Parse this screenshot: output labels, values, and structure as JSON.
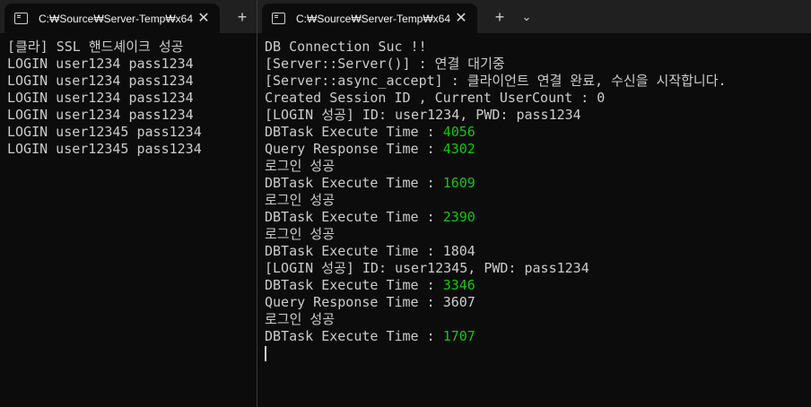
{
  "left_pane": {
    "tab_title": "C:₩Source₩Server-Temp₩x64",
    "lines": [
      "[클라] SSL 핸드셰이크 성공",
      "LOGIN user1234 pass1234",
      "LOGIN user1234 pass1234",
      "LOGIN user1234 pass1234",
      "LOGIN user1234 pass1234",
      "LOGIN user12345 pass1234",
      "LOGIN user12345 pass1234"
    ]
  },
  "right_pane": {
    "tab_title": "C:₩Source₩Server-Temp₩x64",
    "lines": [
      {
        "text": "DB Connection Suc !!"
      },
      {
        "text": "[Server::Server()] : 연결 대기중"
      },
      {
        "text": "[Server::async_accept] : 클라이언트 연결 완료, 수신을 시작합니다."
      },
      {
        "text": "Created Session ID , Current UserCount : 0"
      },
      {
        "text": "[LOGIN 성공] ID: user1234, PWD: pass1234"
      },
      {
        "text": "DBTask Execute Time : ",
        "value": "4056",
        "highlight": true
      },
      {
        "text": "Query Response Time : ",
        "value": "4302",
        "highlight": true
      },
      {
        "text": "로그인 성공"
      },
      {
        "text": "DBTask Execute Time : ",
        "value": "1609",
        "highlight": true
      },
      {
        "text": "로그인 성공"
      },
      {
        "text": "DBTask Execute Time : ",
        "value": "2390",
        "highlight": true
      },
      {
        "text": "로그인 성공"
      },
      {
        "text": "DBTask Execute Time : ",
        "value": "1804",
        "highlight": false
      },
      {
        "text": "[LOGIN 성공] ID: user12345, PWD: pass1234"
      },
      {
        "text": "DBTask Execute Time : ",
        "value": "3346",
        "highlight": true
      },
      {
        "text": "Query Response Time : ",
        "value": "3607",
        "highlight": false
      },
      {
        "text": "로그인 성공"
      },
      {
        "text": "DBTask Execute Time : ",
        "value": "1707",
        "highlight": true
      }
    ]
  },
  "tab_buttons": {
    "close": "✕",
    "new_tab": "+",
    "dropdown": "⌄"
  },
  "colors": {
    "background": "#0c0c0c",
    "tabbar": "#202020",
    "text": "#cccccc",
    "highlight": "#16c60c"
  }
}
